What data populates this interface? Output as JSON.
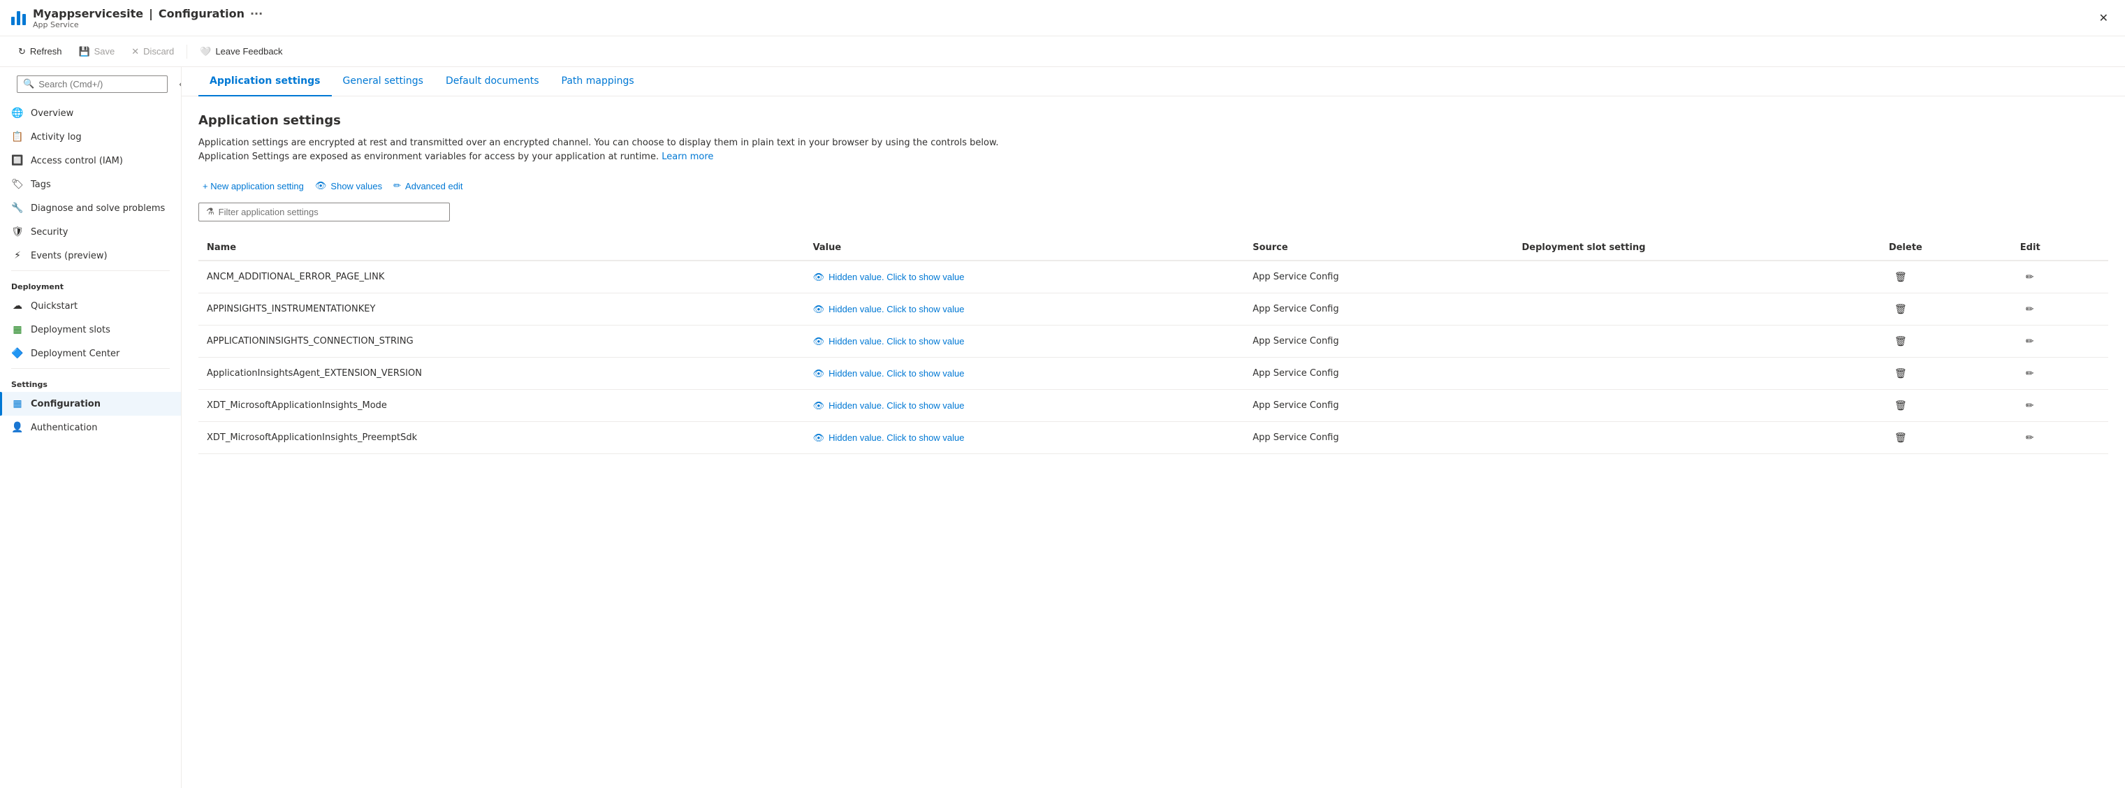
{
  "titleBar": {
    "appName": "Myappservicesite",
    "separator": "|",
    "pageName": "Configuration",
    "subTitle": "App Service",
    "ellipsis": "···",
    "closeLabel": "✕"
  },
  "toolbar": {
    "refresh": "Refresh",
    "save": "Save",
    "discard": "Discard",
    "leaveFeedback": "Leave Feedback"
  },
  "sidebar": {
    "searchPlaceholder": "Search (Cmd+/)",
    "items": [
      {
        "id": "overview",
        "label": "Overview",
        "icon": "🌐"
      },
      {
        "id": "activity-log",
        "label": "Activity log",
        "icon": "📋"
      },
      {
        "id": "access-control",
        "label": "Access control (IAM)",
        "icon": "🔲"
      },
      {
        "id": "tags",
        "label": "Tags",
        "icon": "🔖"
      },
      {
        "id": "diagnose",
        "label": "Diagnose and solve problems",
        "icon": "🔧"
      },
      {
        "id": "security",
        "label": "Security",
        "icon": "🛡"
      },
      {
        "id": "events",
        "label": "Events (preview)",
        "icon": "⚡"
      }
    ],
    "sections": [
      {
        "label": "Deployment",
        "items": [
          {
            "id": "quickstart",
            "label": "Quickstart",
            "icon": "☁"
          },
          {
            "id": "deployment-slots",
            "label": "Deployment slots",
            "icon": "🟩"
          },
          {
            "id": "deployment-center",
            "label": "Deployment Center",
            "icon": "🔷"
          }
        ]
      },
      {
        "label": "Settings",
        "items": [
          {
            "id": "configuration",
            "label": "Configuration",
            "icon": "▦",
            "active": true
          },
          {
            "id": "authentication",
            "label": "Authentication",
            "icon": "👤"
          }
        ]
      }
    ]
  },
  "tabs": [
    {
      "id": "application-settings",
      "label": "Application settings",
      "active": true
    },
    {
      "id": "general-settings",
      "label": "General settings"
    },
    {
      "id": "default-documents",
      "label": "Default documents"
    },
    {
      "id": "path-mappings",
      "label": "Path mappings"
    }
  ],
  "pageTitle": "Application settings",
  "description": "Application settings are encrypted at rest and transmitted over an encrypted channel. You can choose to display them in plain text in your browser by using the controls below. Application Settings are exposed as environment variables for access by your application at runtime.",
  "learnMoreText": "Learn more",
  "actions": {
    "newSetting": "+ New application setting",
    "showValues": "Show values",
    "advancedEdit": "Advanced edit"
  },
  "filterPlaceholder": "Filter application settings",
  "tableHeaders": {
    "name": "Name",
    "value": "Value",
    "source": "Source",
    "deploymentSlotSetting": "Deployment slot setting",
    "delete": "Delete",
    "edit": "Edit"
  },
  "hiddenValueText": "Hidden value. Click to show value",
  "rows": [
    {
      "name": "ANCM_ADDITIONAL_ERROR_PAGE_LINK",
      "source": "App Service Config"
    },
    {
      "name": "APPINSIGHTS_INSTRUMENTATIONKEY",
      "source": "App Service Config"
    },
    {
      "name": "APPLICATIONINSIGHTS_CONNECTION_STRING",
      "source": "App Service Config"
    },
    {
      "name": "ApplicationInsightsAgent_EXTENSION_VERSION",
      "source": "App Service Config"
    },
    {
      "name": "XDT_MicrosoftApplicationInsights_Mode",
      "source": "App Service Config"
    },
    {
      "name": "XDT_MicrosoftApplicationInsights_PreemptSdk",
      "source": "App Service Config"
    }
  ]
}
